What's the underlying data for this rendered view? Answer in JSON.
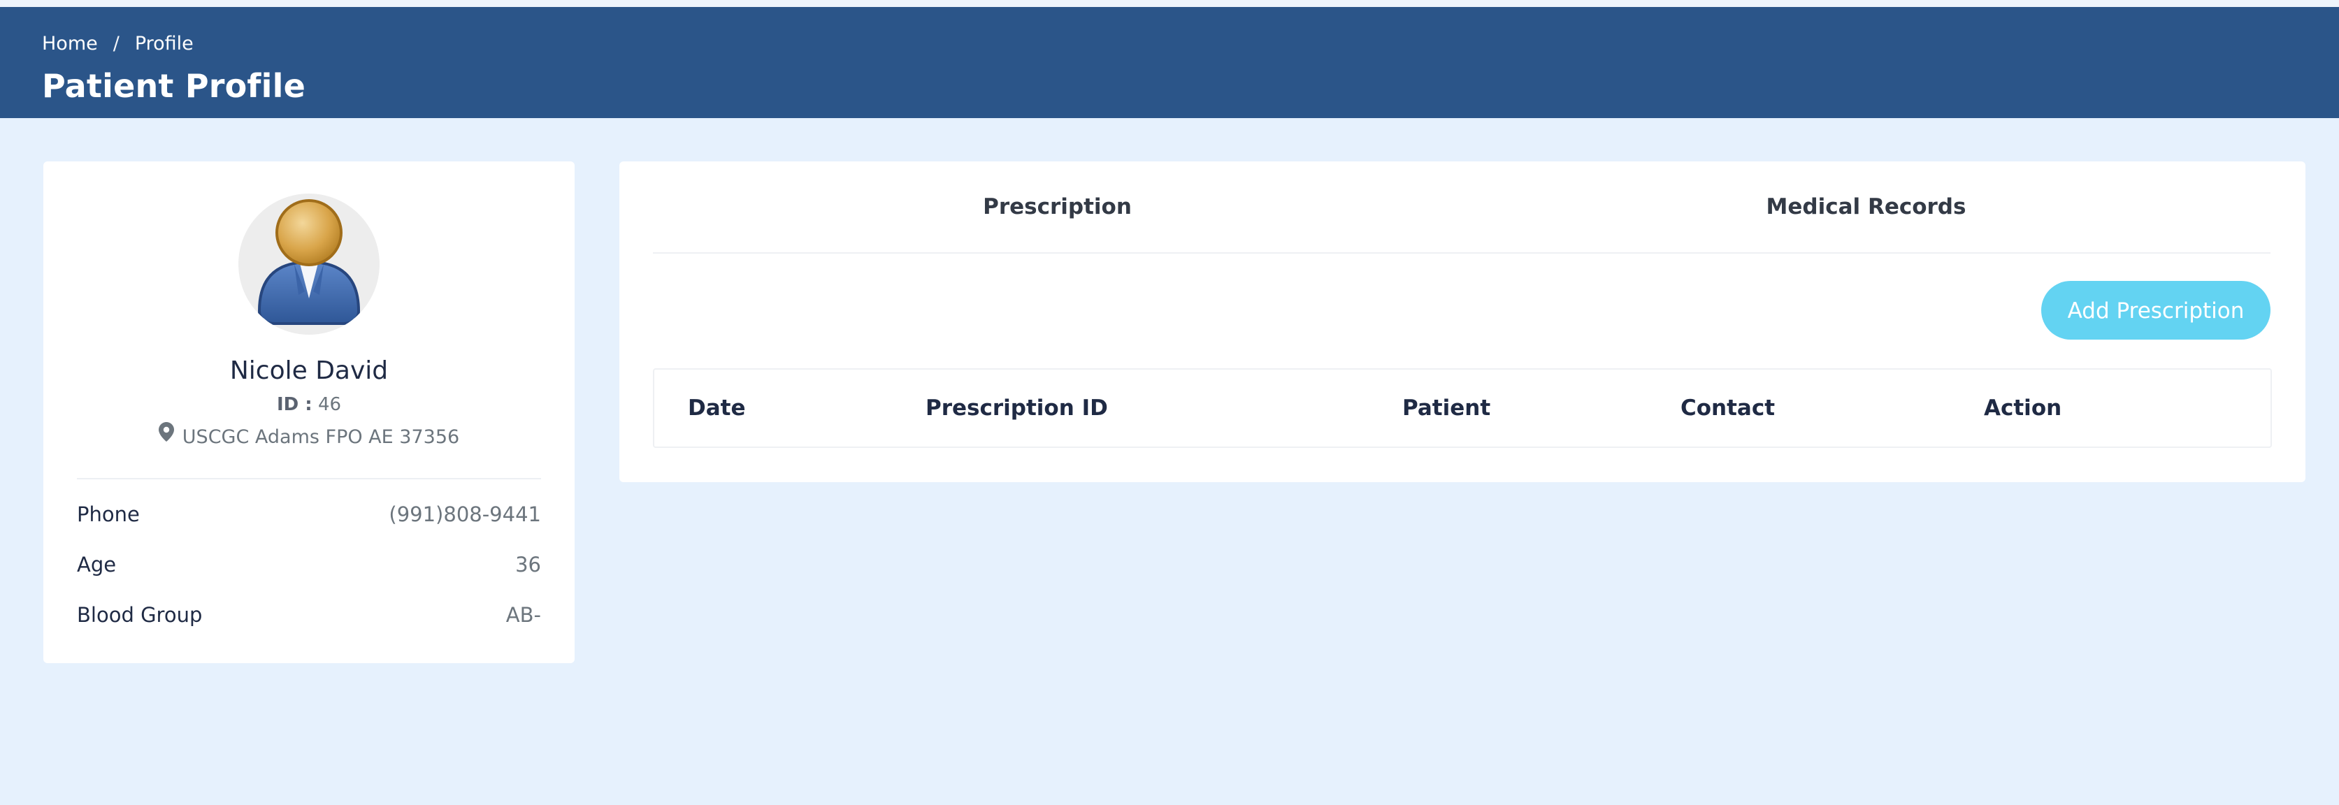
{
  "breadcrumb": {
    "home": "Home",
    "separator": "/",
    "current": "Profile"
  },
  "page_title": "Patient Profile",
  "profile": {
    "name": "Nicole David",
    "id_label": "ID :",
    "id_value": "46",
    "address": "USCGC Adams FPO AE 37356",
    "details": {
      "phone_label": "Phone",
      "phone_value": "(991)808-9441",
      "age_label": "Age",
      "age_value": "36",
      "blood_label": "Blood Group",
      "blood_value": "AB-"
    }
  },
  "tabs": {
    "prescription": "Prescription",
    "medical_records": "Medical Records"
  },
  "add_button": "Add Prescription",
  "table": {
    "columns": [
      "Date",
      "Prescription ID",
      "Patient",
      "Contact",
      "Action"
    ],
    "rows": []
  },
  "colors": {
    "header_bg": "#2b5589",
    "page_bg": "#e6f1fd",
    "button_bg": "#63d3f2"
  },
  "icons": {
    "avatar": "user-avatar-icon",
    "location": "map-pin-icon"
  }
}
